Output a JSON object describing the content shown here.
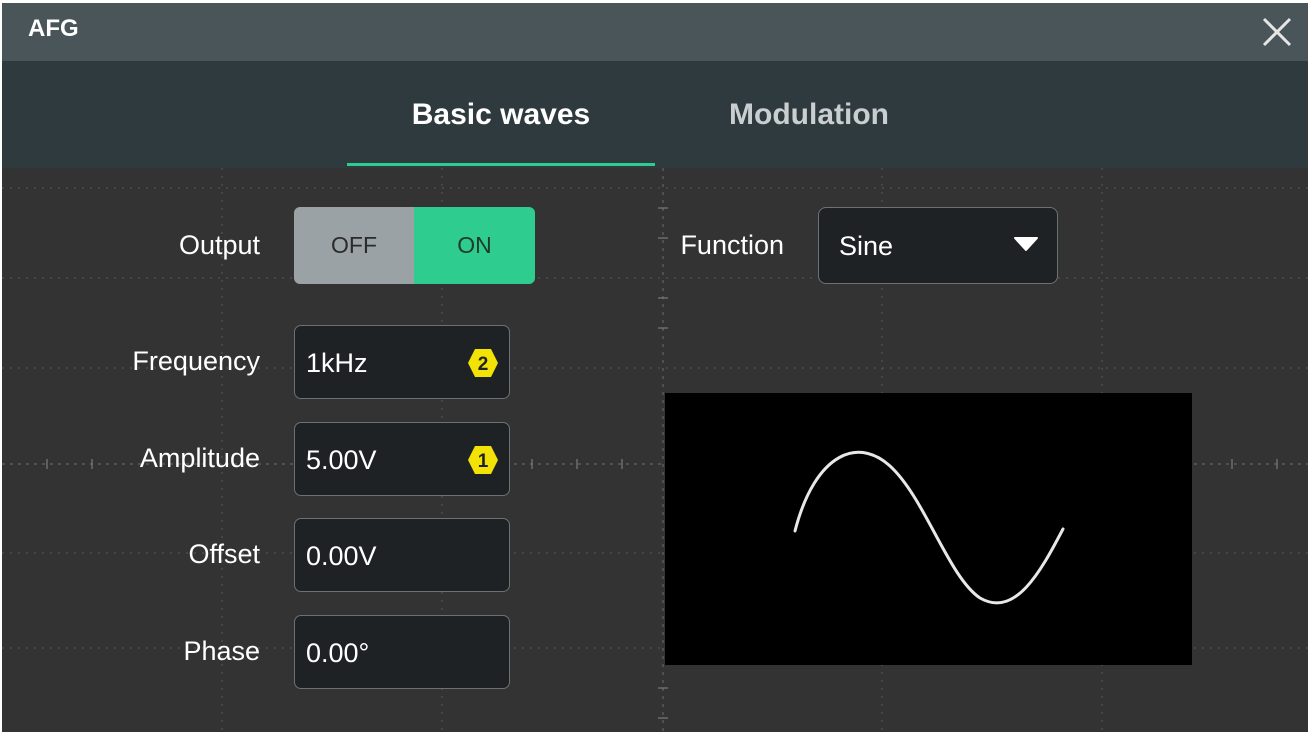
{
  "window": {
    "title": "AFG"
  },
  "tabs": [
    {
      "label": "Basic waves",
      "active": true
    },
    {
      "label": "Modulation",
      "active": false
    }
  ],
  "output": {
    "label": "Output",
    "off_label": "OFF",
    "on_label": "ON",
    "state": "ON"
  },
  "function": {
    "label": "Function",
    "selected": "Sine"
  },
  "params": {
    "frequency": {
      "label": "Frequency",
      "value": "1kHz",
      "badge": "2"
    },
    "amplitude": {
      "label": "Amplitude",
      "value": "5.00V",
      "badge": "1"
    },
    "offset": {
      "label": "Offset",
      "value": "0.00V"
    },
    "phase": {
      "label": "Phase",
      "value": "0.00°"
    }
  },
  "colors": {
    "accent": "#2ecc8f",
    "badge": "#f2e205",
    "background": "#333333",
    "titlebar": "#4a5559",
    "tabbar": "#2f3a3e"
  },
  "icons": {
    "close": "close-icon",
    "dropdown": "caret-down-icon",
    "badge": "hexagon-badge-icon"
  }
}
